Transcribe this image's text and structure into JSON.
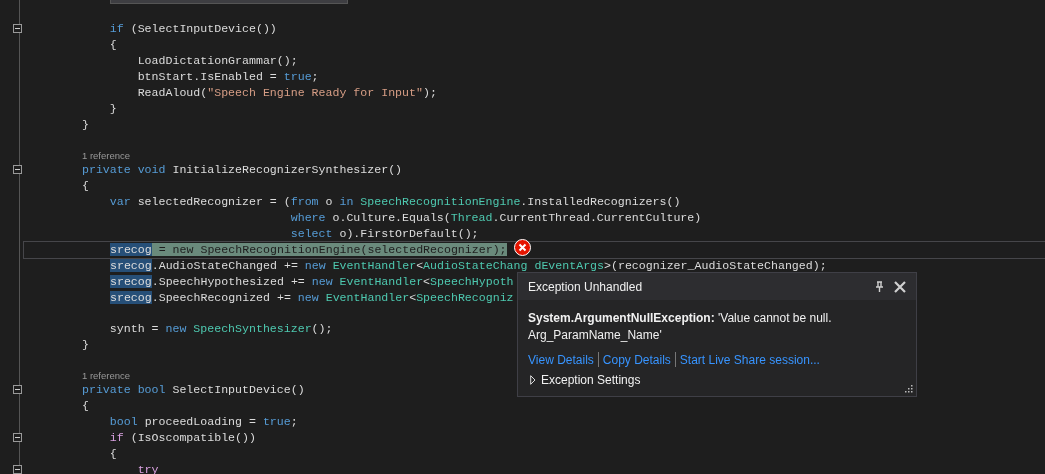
{
  "editor": {
    "lines": [
      {
        "kind": "code",
        "fold": true,
        "tokens": [
          {
            "text": "    if",
            "kind": "keyword"
          },
          {
            "text": " (SelectInputDevice())",
            "kind": "plain"
          }
        ]
      },
      {
        "kind": "code",
        "tokens": [
          {
            "text": "    {",
            "kind": "plain"
          }
        ]
      },
      {
        "kind": "code",
        "tokens": [
          {
            "text": "        LoadDictationGrammar();",
            "kind": "plain"
          }
        ]
      },
      {
        "kind": "code",
        "tokens": [
          {
            "text": "        btnStart.IsEnabled = ",
            "kind": "plain"
          },
          {
            "text": "true",
            "kind": "keyword"
          },
          {
            "text": ";",
            "kind": "plain"
          }
        ]
      },
      {
        "kind": "code",
        "tokens": [
          {
            "text": "        ReadAloud(",
            "kind": "plain"
          },
          {
            "text": "\"Speech Engine Ready for Input\"",
            "kind": "string"
          },
          {
            "text": ");",
            "kind": "plain"
          }
        ]
      },
      {
        "kind": "code",
        "tokens": [
          {
            "text": "    }",
            "kind": "plain"
          }
        ]
      },
      {
        "kind": "code",
        "tokens": [
          {
            "text": "}",
            "kind": "plain"
          }
        ]
      },
      {
        "kind": "blank"
      },
      {
        "kind": "codelens",
        "text": "1 reference"
      },
      {
        "kind": "code",
        "fold": true,
        "tokens": [
          {
            "text": "private void",
            "kind": "keyword"
          },
          {
            "text": " InitializeRecognizerSynthesizer()",
            "kind": "plain"
          }
        ]
      },
      {
        "kind": "code",
        "tokens": [
          {
            "text": "{",
            "kind": "plain"
          }
        ]
      },
      {
        "kind": "code",
        "tokens": [
          {
            "text": "    var",
            "kind": "keyword"
          },
          {
            "text": " selectedRecognizer = (",
            "kind": "plain"
          },
          {
            "text": "from",
            "kind": "keyword"
          },
          {
            "text": " o ",
            "kind": "plain"
          },
          {
            "text": "in",
            "kind": "keyword"
          },
          {
            "text": " SpeechRecognitionEngine",
            "kind": "type"
          },
          {
            "text": ".InstalledRecognizers()",
            "kind": "plain"
          }
        ]
      },
      {
        "kind": "code",
        "tokens": [
          {
            "text": "                              where",
            "kind": "keyword"
          },
          {
            "text": " o.Culture.Equals(",
            "kind": "plain"
          },
          {
            "text": "Thread",
            "kind": "type"
          },
          {
            "text": ".CurrentThread.CurrentCulture)",
            "kind": "plain"
          }
        ]
      },
      {
        "kind": "code",
        "tokens": [
          {
            "text": "                              select",
            "kind": "keyword"
          },
          {
            "text": " o).FirstOrDefault();",
            "kind": "plain"
          }
        ]
      },
      {
        "kind": "code",
        "current": true,
        "error": true,
        "tokens": [
          {
            "text": "srecog",
            "kind": "reference"
          },
          {
            "text": " = new SpeechRecognitionEngine(selectedRecognizer);",
            "kind": "statement"
          }
        ]
      },
      {
        "kind": "code",
        "tokens": [
          {
            "text": "srecog",
            "kind": "reference"
          },
          {
            "text": ".AudioStateChanged += ",
            "kind": "plain"
          },
          {
            "text": "new",
            "kind": "keyword"
          },
          {
            "text": " EventHandler",
            "kind": "type"
          },
          {
            "text": "<",
            "kind": "plain"
          },
          {
            "text": "AudioStateChang",
            "kind": "type"
          },
          {
            "text": " dEventArgs",
            "kind": "type"
          },
          {
            "text": ">(recognizer_AudioStateChanged);",
            "kind": "plain"
          }
        ]
      },
      {
        "kind": "code",
        "tokens": [
          {
            "text": "srecog",
            "kind": "reference"
          },
          {
            "text": ".SpeechHypothesized += ",
            "kind": "plain"
          },
          {
            "text": "new",
            "kind": "keyword"
          },
          {
            "text": " EventHandler",
            "kind": "type"
          },
          {
            "text": "<",
            "kind": "plain"
          },
          {
            "text": "SpeechHypoth",
            "kind": "type"
          }
        ]
      },
      {
        "kind": "code",
        "tokens": [
          {
            "text": "srecog",
            "kind": "reference"
          },
          {
            "text": ".SpeechRecognized += ",
            "kind": "plain"
          },
          {
            "text": "new",
            "kind": "keyword"
          },
          {
            "text": " EventHandler",
            "kind": "type"
          },
          {
            "text": "<",
            "kind": "plain"
          },
          {
            "text": "SpeechRecogniz",
            "kind": "type"
          }
        ]
      },
      {
        "kind": "blank"
      },
      {
        "kind": "code",
        "tokens": [
          {
            "text": "    synth = ",
            "kind": "plain"
          },
          {
            "text": "new",
            "kind": "keyword"
          },
          {
            "text": " SpeechSynthesizer",
            "kind": "type"
          },
          {
            "text": "();",
            "kind": "plain"
          }
        ]
      },
      {
        "kind": "code",
        "tokens": [
          {
            "text": "}",
            "kind": "plain"
          }
        ]
      },
      {
        "kind": "blank"
      },
      {
        "kind": "codelens",
        "text": "1 reference"
      },
      {
        "kind": "code",
        "fold": true,
        "tokens": [
          {
            "text": "private bool",
            "kind": "keyword"
          },
          {
            "text": " SelectInputDevice()",
            "kind": "plain"
          }
        ]
      },
      {
        "kind": "code",
        "tokens": [
          {
            "text": "{",
            "kind": "plain"
          }
        ]
      },
      {
        "kind": "code",
        "tokens": [
          {
            "text": "    bool",
            "kind": "keyword"
          },
          {
            "text": " proceedLoading = ",
            "kind": "plain"
          },
          {
            "text": "true",
            "kind": "keyword"
          },
          {
            "text": ";",
            "kind": "plain"
          }
        ]
      },
      {
        "kind": "code",
        "fold": true,
        "tokens": [
          {
            "text": "    if",
            "kind": "control"
          },
          {
            "text": " (IsOscompatible())",
            "kind": "plain"
          }
        ]
      },
      {
        "kind": "code",
        "tokens": [
          {
            "text": "    {",
            "kind": "plain"
          }
        ]
      },
      {
        "kind": "code",
        "fold": true,
        "tokens": [
          {
            "text": "        try",
            "kind": "control"
          }
        ]
      }
    ]
  },
  "exception_popup": {
    "title": "Exception Unhandled",
    "message": "**System.ArgumentNullException:** 'Value cannot be null.\nArg_ParamName_Name'",
    "links": [
      "View Details",
      "Copy Details",
      "Start Live Share session..."
    ],
    "settings": {
      "label": "Exception Settings",
      "expanded": false
    }
  }
}
